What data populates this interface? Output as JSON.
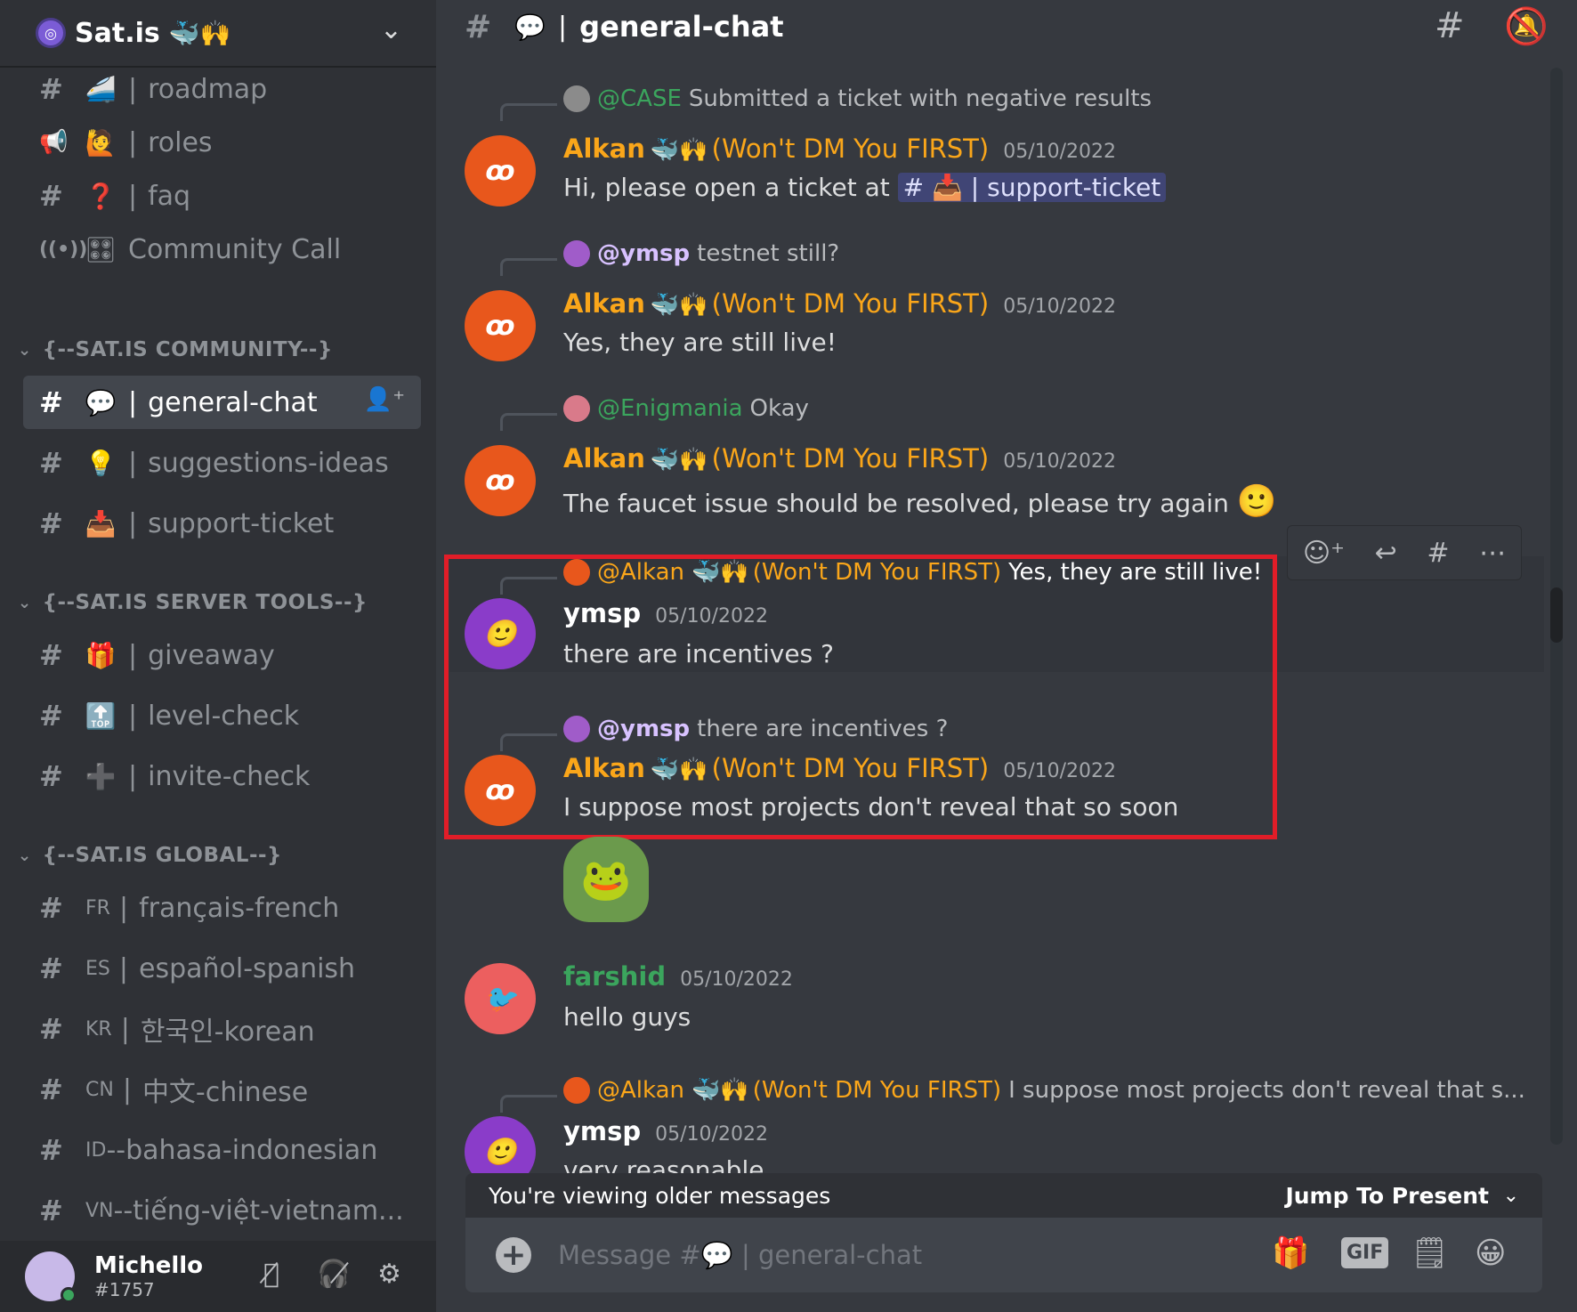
{
  "server": {
    "name": "Sat.is",
    "badges": "🐳🙌"
  },
  "sidebar": {
    "top_channels": [
      {
        "icon": "#",
        "emoji": "🚄",
        "name": "roadmap"
      },
      {
        "icon": "📢",
        "emoji": "🙋",
        "name": "roles"
      },
      {
        "icon": "#",
        "emoji": "❓",
        "name": "faq"
      },
      {
        "icon": "((•))",
        "emoji": "🎛",
        "name": "Community Call"
      }
    ],
    "categories": [
      {
        "name": "{--SAT.IS COMMUNITY--}",
        "channels": [
          {
            "emoji": "💬",
            "name": "general-chat"
          },
          {
            "emoji": "💡",
            "name": "suggestions-ideas"
          },
          {
            "emoji": "📥",
            "name": "support-ticket"
          }
        ]
      },
      {
        "name": "{--SAT.IS SERVER TOOLS--}",
        "channels": [
          {
            "emoji": "🎁",
            "name": "giveaway"
          },
          {
            "emoji": "🔝",
            "name": "level-check"
          },
          {
            "emoji": "➕",
            "name": "invite-check"
          }
        ]
      },
      {
        "name": "{--SAT.IS GLOBAL--}",
        "channels": [
          {
            "lang": "FR",
            "name": "français-french"
          },
          {
            "lang": "ES",
            "name": "español-spanish"
          },
          {
            "lang": "KR",
            "name": "한국인-korean"
          },
          {
            "lang": "CN",
            "name": "中文-chinese"
          },
          {
            "lang": "ID",
            "name": "--bahasa-indonesian"
          },
          {
            "lang": "VN",
            "name": "--tiếng-việt-vietnam..."
          }
        ]
      }
    ]
  },
  "user": {
    "name": "Michello",
    "discriminator": "#1757"
  },
  "header": {
    "channel_emoji": "💬",
    "channel_name": "general-chat"
  },
  "messages": [
    {
      "reply_name": "@CASE",
      "reply_text": "Submitted a ticket with negative results",
      "author": "Alkan",
      "badges": "🐳🙌",
      "tag": "(Won't DM You FIRST)",
      "time": "05/10/2022",
      "text_before": "Hi, please open a ticket at",
      "mention": "# 📥 | support-ticket"
    },
    {
      "reply_name": "@ymsp",
      "reply_text": "testnet still?",
      "author": "Alkan",
      "badges": "🐳🙌",
      "tag": "(Won't DM You FIRST)",
      "time": "05/10/2022",
      "text": "Yes, they are still live!"
    },
    {
      "reply_name": "@Enigmania",
      "reply_text": "Okay",
      "author": "Alkan",
      "badges": "🐳🙌",
      "tag": "(Won't DM You FIRST)",
      "time": "05/10/2022",
      "text": "The faucet issue should be resolved, please try again",
      "emoji": "🙂"
    },
    {
      "reply_name": "@Alkan",
      "reply_badges": "🐳🙌",
      "reply_tag": "(Won't DM You FIRST)",
      "reply_text": "Yes, they are still live!",
      "author": "ymsp",
      "time": "05/10/2022",
      "text": "there are incentives ?"
    },
    {
      "reply_name": "@ymsp",
      "reply_text": "there are incentives ?",
      "author": "Alkan",
      "badges": "🐳🙌",
      "tag": "(Won't DM You FIRST)",
      "time": "05/10/2022",
      "text": "I suppose most projects don't reveal that so soon"
    },
    {
      "author": "farshid",
      "time": "05/10/2022",
      "text": "hello guys"
    },
    {
      "reply_name": "@Alkan",
      "reply_badges": "🐳🙌",
      "reply_tag": "(Won't DM You FIRST)",
      "reply_text": "I suppose most projects don't reveal that s...",
      "author": "ymsp",
      "time": "05/10/2022",
      "text": "very reasonable"
    }
  ],
  "older_bar": {
    "text": "You're viewing older messages",
    "jump": "Jump To Present"
  },
  "composer": {
    "placeholder_prefix": "Message #",
    "placeholder_emoji": "💬",
    "placeholder_channel": "| general-chat",
    "gif": "GIF"
  },
  "colors": {
    "accent_orange": "#faa61a",
    "accent_green": "#3ba55d",
    "highlight_red": "#e11d28"
  }
}
